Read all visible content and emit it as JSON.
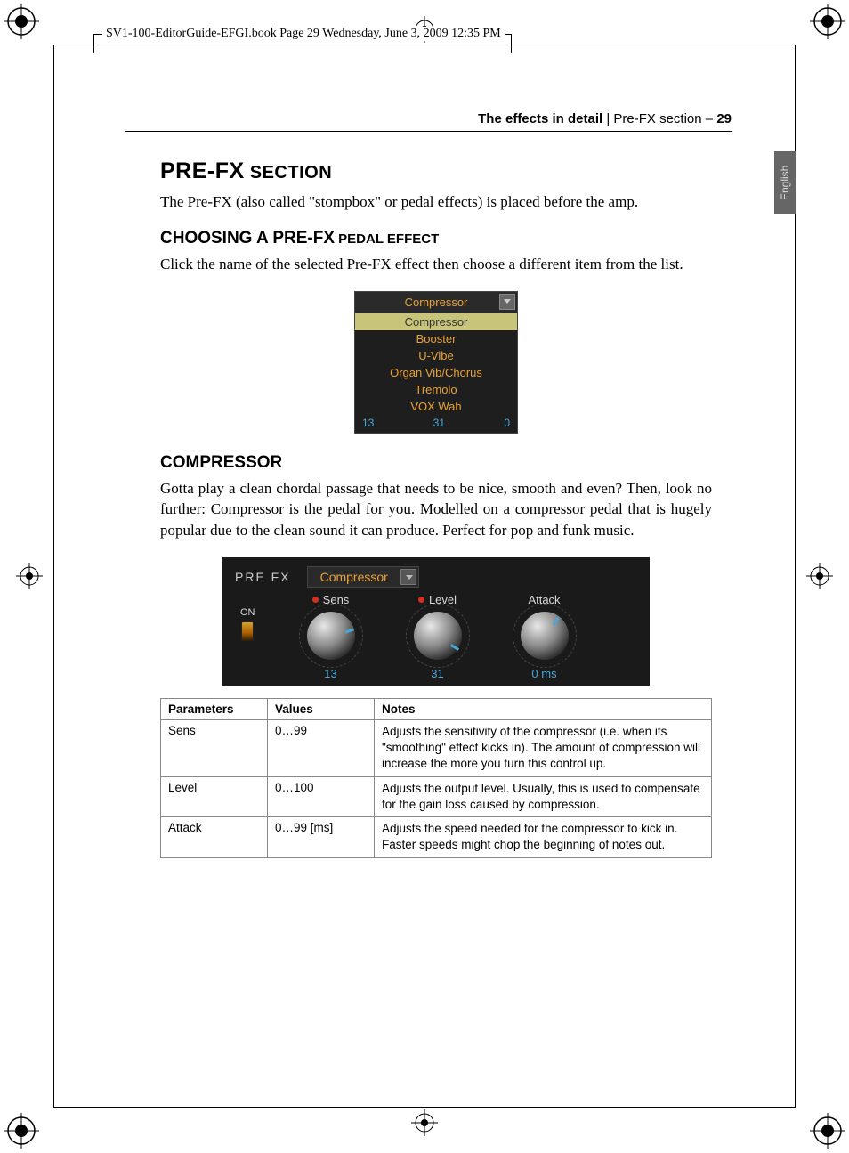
{
  "frame_header": "SV1-100-EditorGuide-EFGI.book  Page 29  Wednesday, June 3, 2009  12:35 PM",
  "running_head": {
    "bold": "The effects in detail",
    "sep": " | ",
    "light": "Pre-FX section – ",
    "page": "29"
  },
  "lang_tab": "English",
  "h1_main": "PRE-FX",
  "h1_tail": " SECTION",
  "intro_text": "The Pre-FX (also called \"stompbox\" or pedal effects) is placed before the amp.",
  "h2a_main": "CHOOSING A PRE-FX",
  "h2a_tail": " PEDAL EFFECT",
  "choosing_text": "Click the name of the selected Pre-FX effect then choose a different item from the list.",
  "dropdown": {
    "header": "Compressor",
    "items": [
      "Compressor",
      "Booster",
      "U-Vibe",
      "Organ Vib/Chorus",
      "Tremolo",
      "VOX Wah"
    ],
    "selected_index": 0,
    "footer_left": "13",
    "footer_mid": "31",
    "footer_right": "0"
  },
  "h2b_main": "COMPRESSOR",
  "compressor_text": "Gotta play a clean chordal passage that needs to be nice, smooth and even? Then, look no further: Compressor is the pedal for you. Modelled on a compressor pedal that is hugely popular due to the clean sound it can produce. Perfect for pop and funk music.",
  "panel": {
    "label": "PRE FX",
    "selected": "Compressor",
    "on_label": "ON",
    "knobs": [
      {
        "label": "Sens",
        "value": "13",
        "has_dot": true
      },
      {
        "label": "Level",
        "value": "31",
        "has_dot": true
      },
      {
        "label": "Attack",
        "value": "0 ms",
        "has_dot": false
      }
    ]
  },
  "table": {
    "headers": [
      "Parameters",
      "Values",
      "Notes"
    ],
    "rows": [
      {
        "param": "Sens",
        "values": "0…99",
        "notes": "Adjusts the sensitivity of the compressor (i.e. when its \"smoothing\" effect kicks in). The amount of compression will increase the more you turn this control up."
      },
      {
        "param": "Level",
        "values": "0…100",
        "notes": "Adjusts the output level. Usually, this is used to compensate for the gain loss caused by compression."
      },
      {
        "param": "Attack",
        "values": "0…99 [ms]",
        "notes": "Adjusts the speed needed for the compressor to kick in. Faster speeds might chop the beginning of notes out."
      }
    ]
  }
}
